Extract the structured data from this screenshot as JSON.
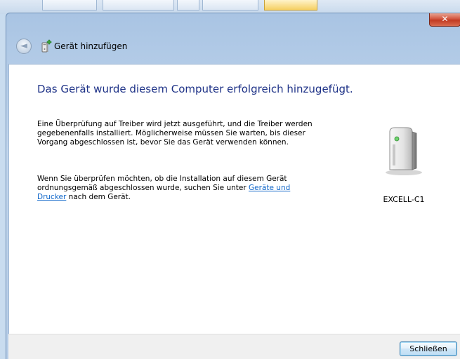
{
  "window": {
    "close_glyph": "✕",
    "back_glyph": "◄",
    "nav_title": "Gerät hinzufügen"
  },
  "content": {
    "headline": "Das Gerät wurde diesem Computer erfolgreich hinzugefügt.",
    "paragraph1": "Eine Überprüfung auf Treiber wird jetzt ausgeführt, und die Treiber werden gegebenenfalls installiert. Möglicherweise müssen Sie warten, bis dieser Vorgang abgeschlossen ist, bevor Sie das Gerät verwenden können.",
    "paragraph2_before": "Wenn Sie überprüfen möchten, ob die Installation auf diesem Gerät ordnungsgemäß abgeschlossen wurde, suchen Sie unter ",
    "paragraph2_link": "Geräte und Drucker",
    "paragraph2_after": " nach dem Gerät.",
    "device_icon": "computer-device-icon",
    "device_name": "EXCELL-C1"
  },
  "footer": {
    "close_button_label": "Schließen"
  },
  "colors": {
    "headline": "#1e3287",
    "link": "#1066c9",
    "close_red": "#c23a22"
  }
}
